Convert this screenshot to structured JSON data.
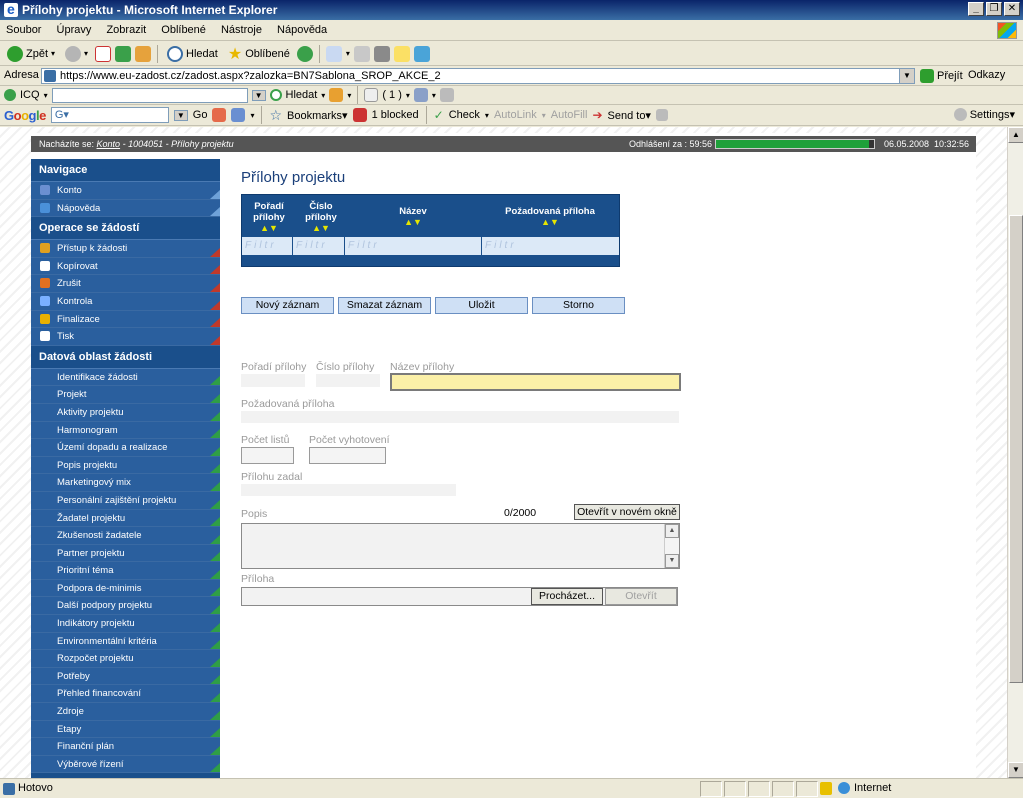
{
  "window": {
    "title": "Přílohy projektu - Microsoft Internet Explorer",
    "controls": [
      "_",
      "❐",
      "✕"
    ]
  },
  "menu": [
    "Soubor",
    "Úpravy",
    "Zobrazit",
    "Oblíbené",
    "Nástroje",
    "Nápověda"
  ],
  "toolbar": {
    "back": "Zpět",
    "search": "Hledat",
    "favorites": "Oblíbené"
  },
  "address": {
    "label": "Adresa",
    "url": "https://www.eu-zadost.cz/zadost.aspx?zalozka=BN7Sablona_SROP_AKCE_2",
    "go": "Přejít",
    "links": "Odkazy"
  },
  "icq": {
    "label": "ICQ",
    "search": "Hledat",
    "count": "( 1 )"
  },
  "google": {
    "logo": "Google",
    "input": "G▾",
    "go": "Go",
    "bookmarks": "Bookmarks▾",
    "blocked": "1 blocked",
    "check": "Check",
    "autolink": "AutoLink",
    "autofill": "AutoFill",
    "sendto": "Send to▾",
    "settings": "Settings▾"
  },
  "breadcrumb": {
    "prefix": "Nacházíte se:",
    "link": "Konto",
    "rest": "- 1004051 - Přílohy projektu",
    "logout": "Odhlášení za : 59:56",
    "session_progress": 0.97,
    "date": "06.05.2008",
    "time": "10:32:56"
  },
  "sidebar": {
    "nav_head": "Navigace",
    "nav": [
      {
        "label": "Konto",
        "icon": "account-icon",
        "color": "#6b8fd1"
      },
      {
        "label": "Nápověda",
        "icon": "help-icon",
        "color": "#4a90d9"
      }
    ],
    "ops_head": "Operace se žádostí",
    "ops": [
      {
        "label": "Přístup k žádosti",
        "icon": "users-icon",
        "color": "#e0a020"
      },
      {
        "label": "Kopírovat",
        "icon": "copy-icon",
        "color": "#ffffff"
      },
      {
        "label": "Zrušit",
        "icon": "cancel-icon",
        "color": "#e07020"
      },
      {
        "label": "Kontrola",
        "icon": "check-icon",
        "color": "#7ab0ff"
      },
      {
        "label": "Finalizace",
        "icon": "lock-icon",
        "color": "#e8b000"
      },
      {
        "label": "Tisk",
        "icon": "print-icon",
        "color": "#ffffff"
      }
    ],
    "data_head": "Datová oblast žádosti",
    "data": [
      "Identifikace žádosti",
      "Projekt",
      "Aktivity projektu",
      "Harmonogram",
      "Území dopadu a realizace",
      "Popis projektu",
      "Marketingový mix",
      "Personální zajištění projektu",
      "Žadatel projektu",
      "Zkušenosti žadatele",
      "Partner projektu",
      "Prioritní téma",
      "Podpora de-minimis",
      "Další podpory projektu",
      "Indikátory projektu",
      "Environmentální kritéria",
      "Rozpočet projektu",
      "Potřeby",
      "Přehled financování",
      "Zdroje",
      "Etapy",
      "Finanční plán",
      "Výběrové řízení"
    ]
  },
  "main": {
    "title": "Přílohy projektu",
    "grid": {
      "columns": [
        "Pořadí přílohy",
        "Číslo přílohy",
        "Název",
        "Požadovaná příloha"
      ],
      "sort": "▲▼",
      "filter": "Filtr"
    },
    "buttons": [
      "Nový záznam",
      "Smazat záznam",
      "Uložit",
      "Storno"
    ],
    "form": {
      "poradi": "Pořadí přílohy",
      "cislo": "Číslo přílohy",
      "nazev": "Název přílohy",
      "pozadovana": "Požadovaná příloha",
      "pocet_listu": "Počet listů",
      "pocet_vyhotoveni": "Počet vyhotovení",
      "zadal": "Přílohu zadal",
      "popis": "Popis",
      "counter": "0/2000",
      "open_new": "Otevřít v novém okně",
      "priloha": "Příloha",
      "browse": "Procházet...",
      "open": "Otevřít"
    }
  },
  "status": {
    "text": "Hotovo",
    "zone": "Internet"
  }
}
